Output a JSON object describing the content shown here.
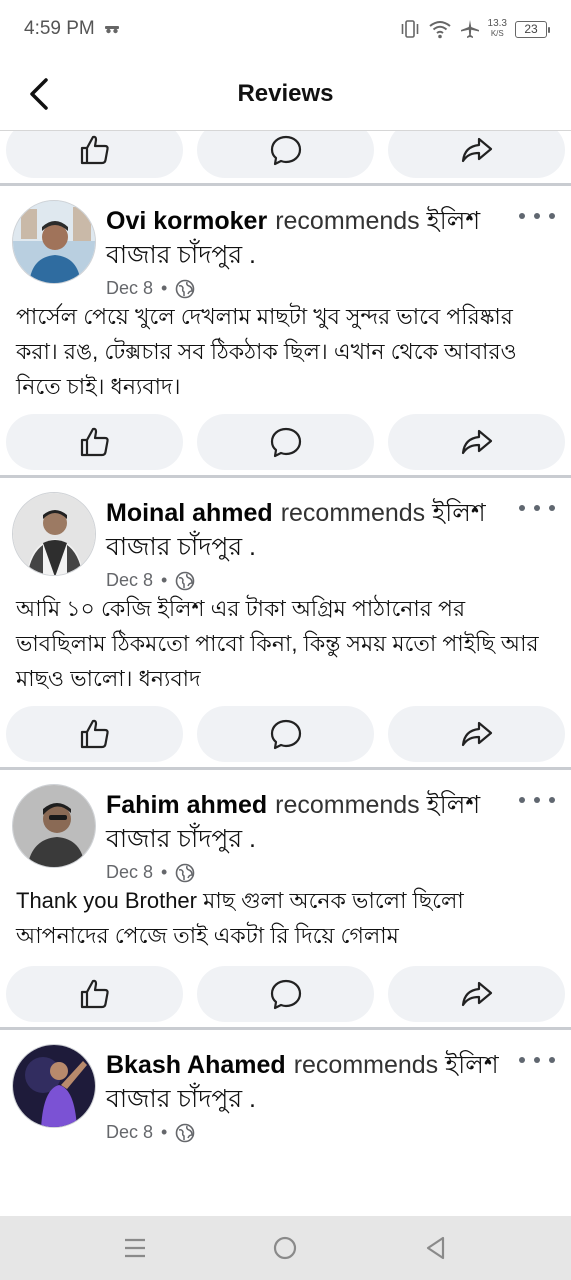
{
  "status_bar": {
    "time": "4:59 PM",
    "speed_value": "13.3",
    "speed_unit": "K/S",
    "battery": "23"
  },
  "header": {
    "title": "Reviews"
  },
  "reviews": [
    {
      "author": "Ovi kormoker",
      "recommends": "recommends",
      "page": "ইলিশ বাজার চাঁদপুর .",
      "date": "Dec 8",
      "text": "পার্সেল পেয়ে খুলে দেখলাম মাছটা খুব সুন্দর ভাবে পরিষ্কার করা। রঙ, টেক্সচার সব ঠিকঠাক ছিল। এখান থেকে আবারও নিতে চাই। ধন্যবাদ।",
      "avatar_colors": [
        "#7aa6c9",
        "#2b5c86"
      ]
    },
    {
      "author": "Moinal ahmed",
      "recommends": "recommends",
      "page": "ইলিশ বাজার চাঁদপুর .",
      "date": "Dec 8",
      "text": "আমি ১০ কেজি ইলিশ  এর টাকা অগ্রিম পাঠানোর পর ভাবছিলাম ঠিকমতো পাবো কিনা, কিন্তু সময় মতো পাইছি আর মাছও ভালো। ধন্যবাদ",
      "avatar_colors": [
        "#cfcfcf",
        "#3a3a3a"
      ]
    },
    {
      "author": "Fahim ahmed",
      "recommends": "recommends",
      "page": "ইলিশ বাজার চাঁদপুর .",
      "date": "Dec 8",
      "text": "Thank you Brother মাছ গুলা অনেক ভালো ছিলো আপনাদের পেজে তাই একটা রি দিয়ে গেলাম",
      "avatar_colors": [
        "#8c8c8c",
        "#2e2e2e"
      ]
    },
    {
      "author": "Bkash Ahamed",
      "recommends": "recommends",
      "page": "ইলিশ বাজার চাঁদপুর .",
      "date": "Dec 8",
      "text": "",
      "avatar_colors": [
        "#2a2550",
        "#7a4fd0"
      ]
    }
  ],
  "icons": {
    "like": "thumbs-up-icon",
    "comment": "comment-bubble-icon",
    "share": "share-arrow-icon",
    "privacy": "globe-icon",
    "more": "more-dots-icon"
  },
  "nav_bar": {
    "recents": "menu-icon",
    "home": "home-circle-icon",
    "back": "back-triangle-icon"
  }
}
